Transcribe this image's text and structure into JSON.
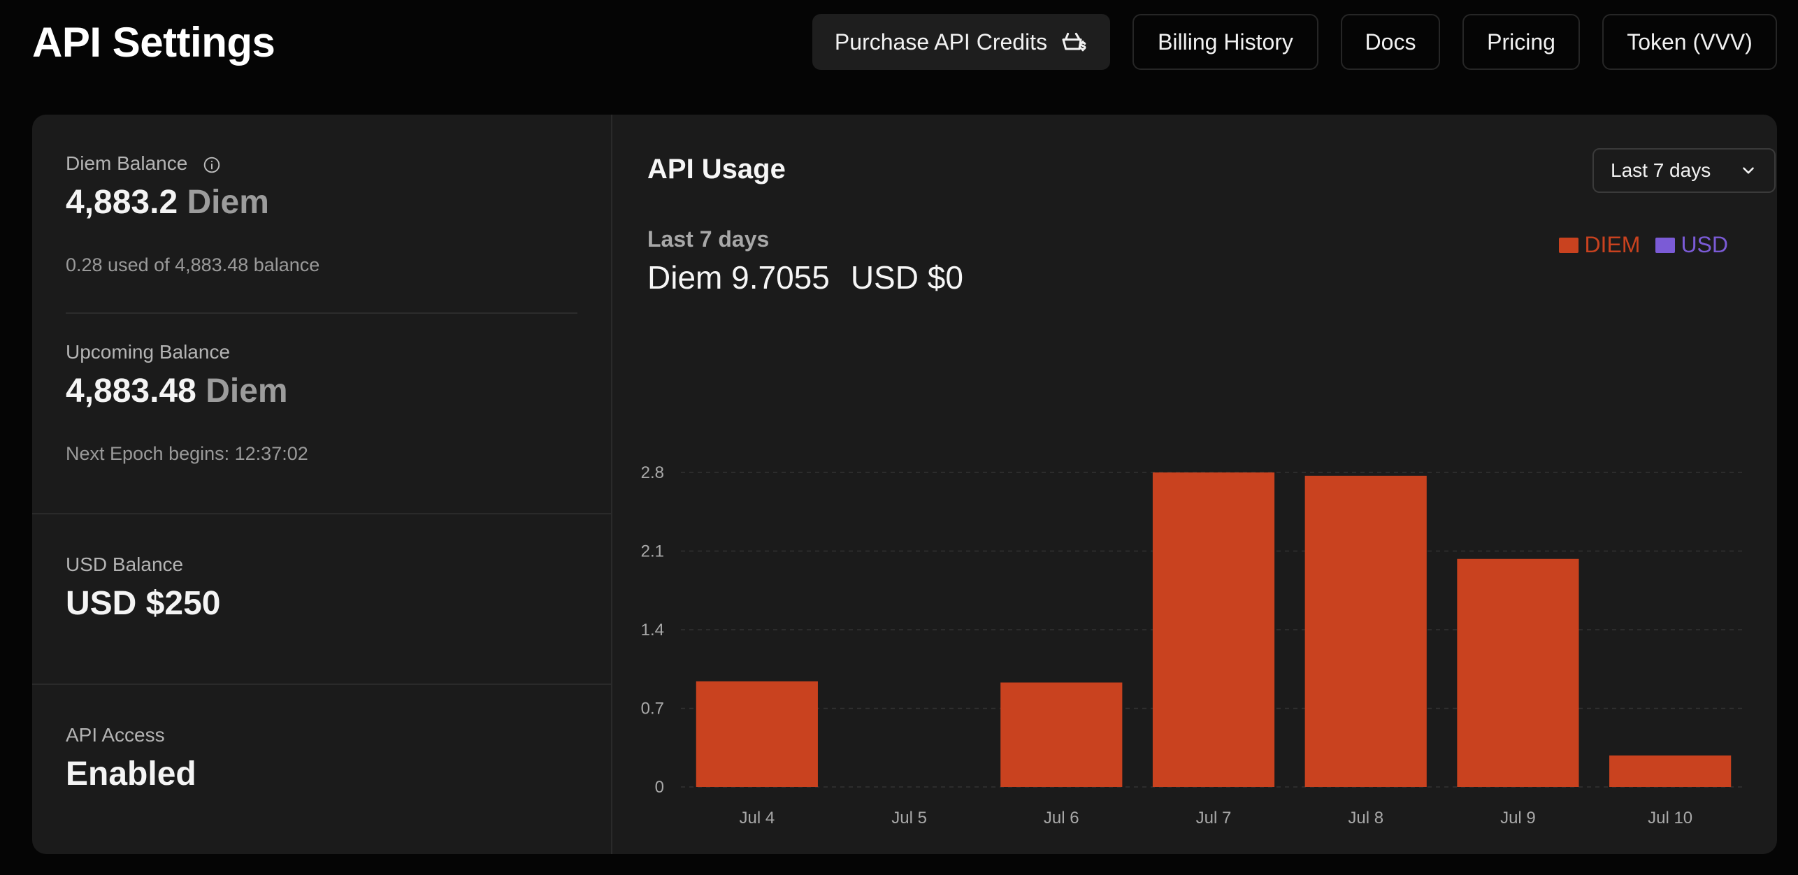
{
  "header": {
    "title": "API Settings",
    "buttons": {
      "purchase": "Purchase API Credits",
      "billing": "Billing History",
      "docs": "Docs",
      "pricing": "Pricing",
      "token": "Token (VVV)"
    }
  },
  "left": {
    "diem_balance": {
      "label": "Diem Balance",
      "amount": "4,883.2",
      "unit": "Diem",
      "sub": "0.28 used of 4,883.48 balance"
    },
    "upcoming_balance": {
      "label": "Upcoming Balance",
      "amount": "4,883.48",
      "unit": "Diem",
      "sub": "Next Epoch begins: 12:37:02"
    },
    "usd_balance": {
      "label": "USD Balance",
      "amount": "USD $250"
    },
    "api_access": {
      "label": "API Access",
      "value": "Enabled"
    }
  },
  "usage": {
    "title": "API Usage",
    "range_select": "Last 7 days",
    "period_label": "Last 7 days",
    "total_diem": "Diem 9.7055",
    "total_usd": "USD $0"
  },
  "colors": {
    "diem": "#c9421f",
    "usd": "#7b5bd6"
  },
  "chart_data": {
    "type": "bar",
    "categories": [
      "Jul 4",
      "Jul 5",
      "Jul 6",
      "Jul 7",
      "Jul 8",
      "Jul 9",
      "Jul 10"
    ],
    "series": [
      {
        "name": "DIEM",
        "values": [
          0.94,
          0,
          0.93,
          2.8,
          2.77,
          2.03,
          0.28
        ]
      },
      {
        "name": "USD",
        "values": [
          0,
          0,
          0,
          0,
          0,
          0,
          0
        ]
      }
    ],
    "yticks": [
      "0",
      "0.7",
      "1.4",
      "2.1",
      "2.8"
    ],
    "ylim": [
      0,
      2.8
    ],
    "grid": true,
    "legend": "top-right",
    "title": "",
    "xlabel": "",
    "ylabel": ""
  }
}
